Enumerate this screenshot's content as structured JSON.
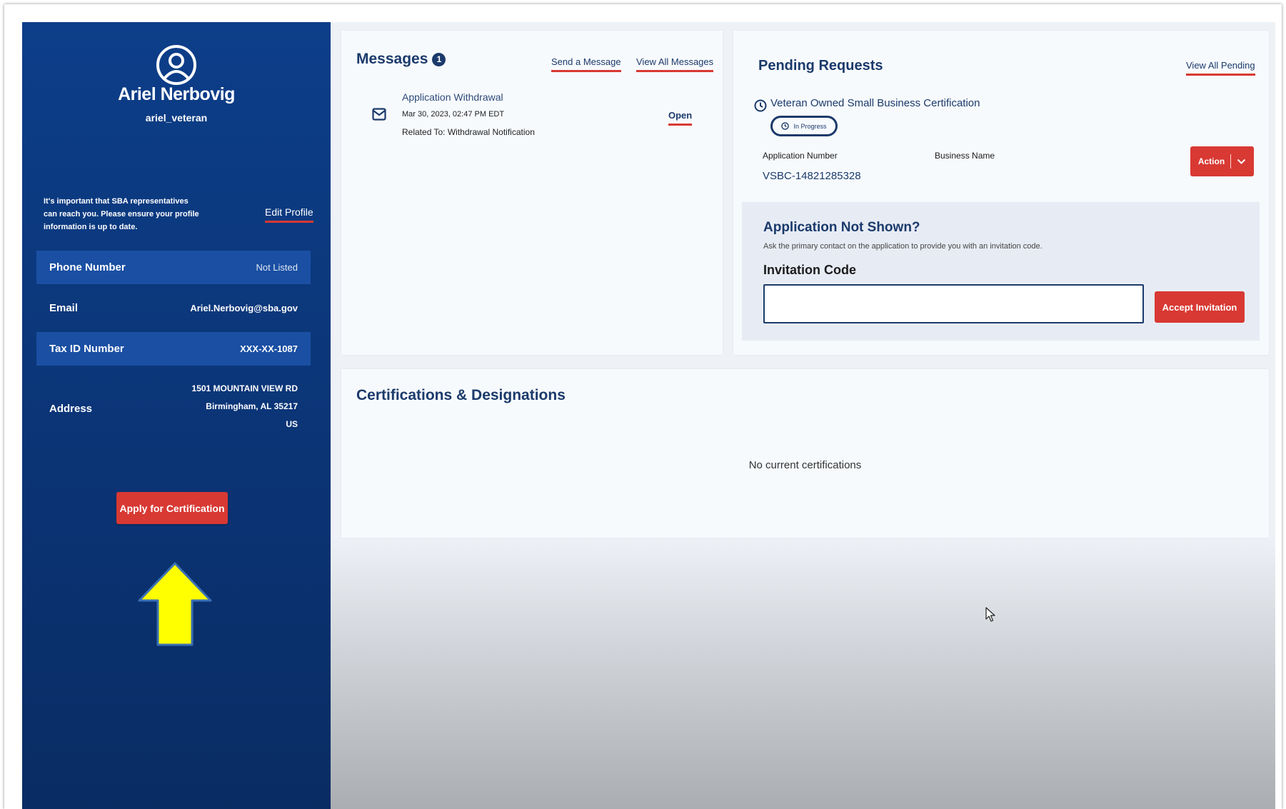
{
  "profile": {
    "avatar_icon": "user-circle-icon",
    "name": "Ariel Nerbovig",
    "username": "ariel_veteran",
    "notice": "It's important that SBA representatives can reach you. Please ensure your profile information is up to date.",
    "edit_profile_label": "Edit Profile",
    "fields": [
      {
        "label": "Phone Number",
        "value": "Not Listed"
      },
      {
        "label": "Email",
        "value": "Ariel.Nerbovig@sba.gov"
      },
      {
        "label": "Tax ID Number",
        "value": "XXX-XX-1087"
      }
    ],
    "address": {
      "label": "Address",
      "line1": "1501 MOUNTAIN VIEW RD",
      "line2": "Birmingham, AL 35217",
      "line3": "US"
    },
    "apply_button_label": "Apply for Certification",
    "annotation_arrow_color": "#ffff00"
  },
  "messages": {
    "title": "Messages",
    "unread_count": "1",
    "send_label": "Send a Message",
    "view_all_label": "View All Messages",
    "items": [
      {
        "icon": "envelope-icon",
        "subject": "Application Withdrawal",
        "date": "Mar 30, 2023, 02:47 PM EDT",
        "related": "Related To: Withdrawal Notification",
        "open_label": "Open"
      }
    ]
  },
  "pending": {
    "title": "Pending Requests",
    "view_all_label": "View All Pending",
    "request": {
      "icon": "clock-icon",
      "title": "Veteran Owned Small Business Certification",
      "status": "In Progress",
      "app_number_label": "Application Number",
      "app_number": "VSBC-14821285328",
      "business_name_label": "Business Name",
      "action_label": "Action"
    },
    "invitation": {
      "title": "Application Not Shown?",
      "description": "Ask the primary contact on the application to provide you with an invitation code.",
      "code_label": "Invitation Code",
      "code_value": "",
      "accept_label": "Accept Invitation"
    }
  },
  "certifications": {
    "title": "Certifications & Designations",
    "empty_text": "No current certifications"
  },
  "colors": {
    "sidebar_blue": "#0b3577",
    "accent_red": "#d83933",
    "heading_navy": "#1b3a6b"
  }
}
